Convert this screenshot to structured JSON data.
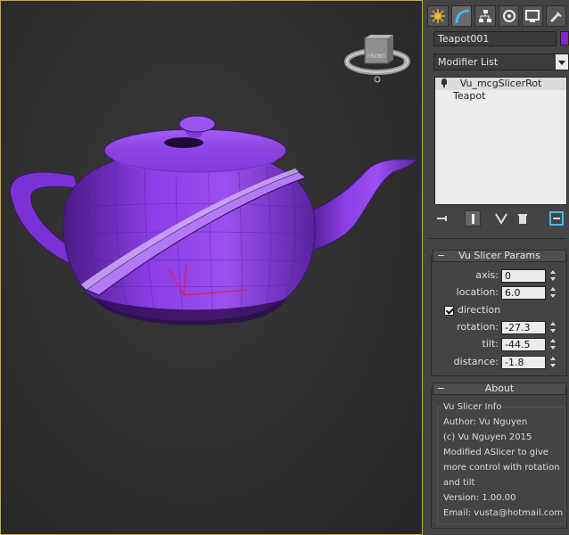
{
  "viewport": {
    "viewcube_label": "FRONT",
    "object_color": "#7b2bd0"
  },
  "command_panel": {
    "tabs": [
      {
        "icon": "create-icon"
      },
      {
        "icon": "modify-icon"
      },
      {
        "icon": "hierarchy-icon"
      },
      {
        "icon": "motion-icon"
      },
      {
        "icon": "display-icon"
      },
      {
        "icon": "utilities-icon"
      }
    ],
    "object_name": "Teapot001",
    "object_color": "#7b2bd0",
    "modifier_list_label": "Modifier List",
    "stack": [
      {
        "label": "Vu_mcgSlicerRot",
        "type": "modifier"
      },
      {
        "label": "Teapot",
        "type": "base"
      }
    ],
    "params": {
      "title": "Vu Slicer Params",
      "axis_label": "axis:",
      "axis_value": "0",
      "location_label": "location:",
      "location_value": "6.0",
      "direction_label": "direction",
      "direction_checked": true,
      "rotation_label": "rotation:",
      "rotation_value": "-27.3",
      "tilt_label": "tilt:",
      "tilt_value": "-44.5",
      "distance_label": "distance:",
      "distance_value": "-1.8"
    },
    "about": {
      "title": "About",
      "group_title": "Vu Slicer Info",
      "lines": [
        "Author: Vu Nguyen",
        "(c) Vu Nguyen 2015",
        "Modified ASlicer to give",
        "more control with rotation",
        "and tilt",
        "Version: 1.00.00",
        "Email: vusta@hotmail.com"
      ]
    }
  }
}
